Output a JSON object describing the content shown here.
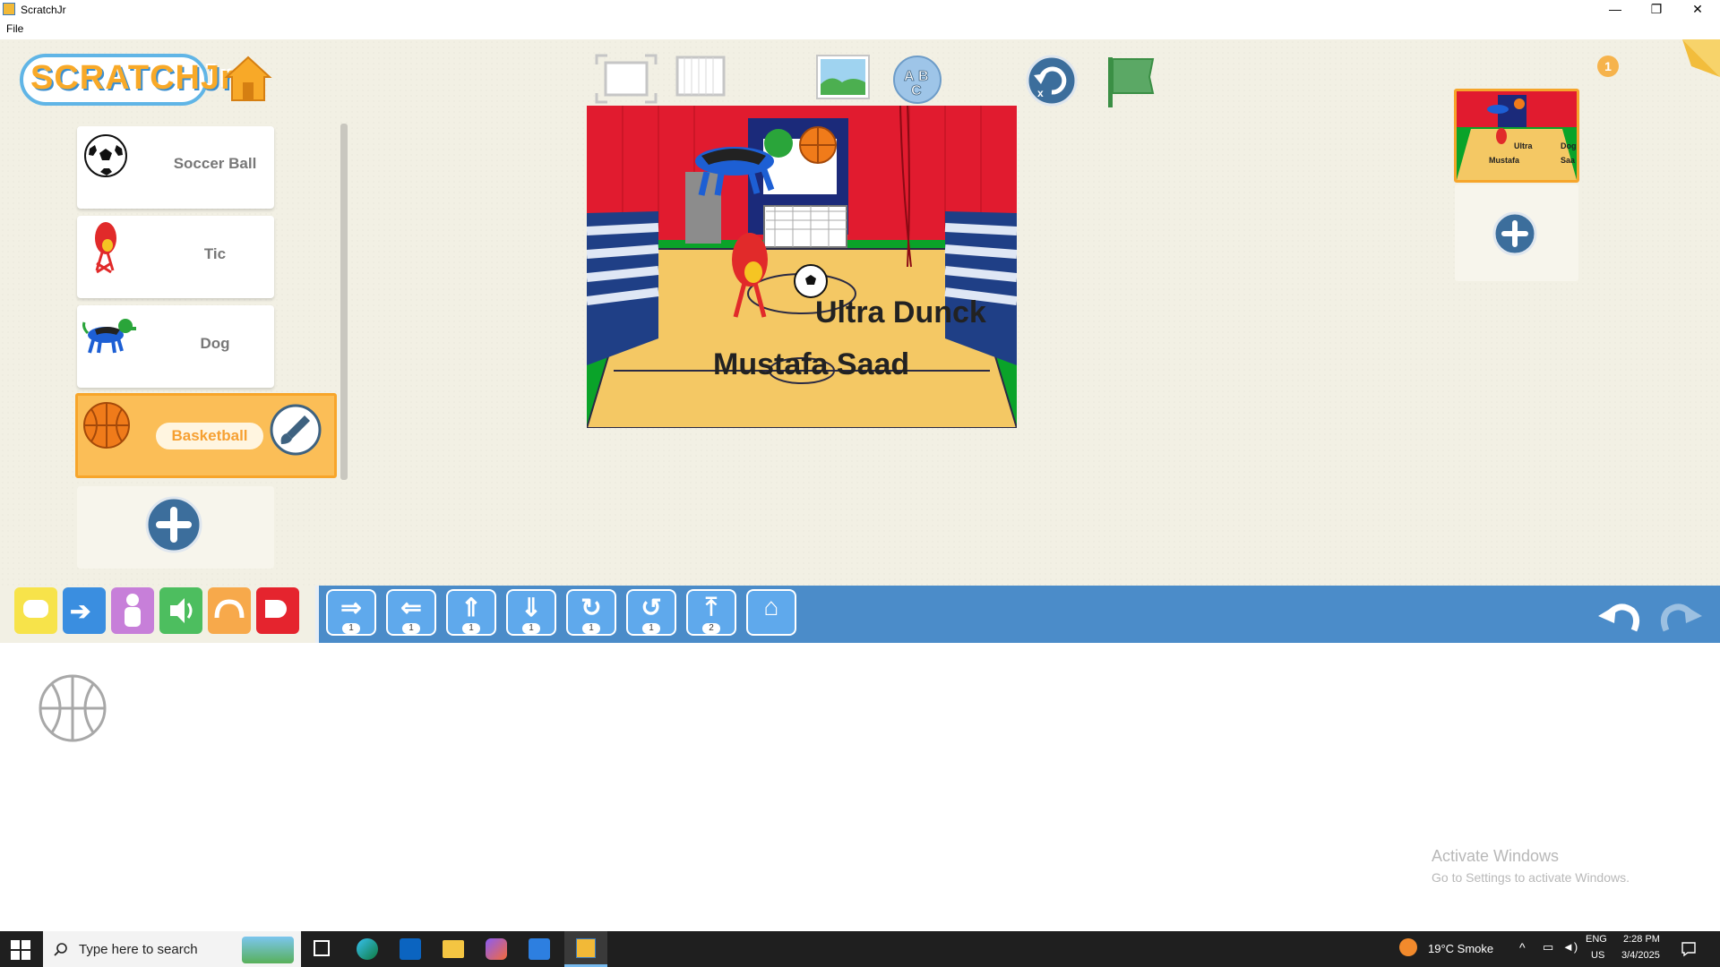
{
  "window": {
    "title": "ScratchJr",
    "minimize": "—",
    "restore": "❐",
    "close": "✕"
  },
  "menu": {
    "file": "File"
  },
  "logo": {
    "text": "SCRATCHJr"
  },
  "sprites": [
    {
      "name": "Soccer Ball",
      "icon": "soccer-ball-icon"
    },
    {
      "name": "Tic",
      "icon": "tic-character-icon"
    },
    {
      "name": "Dog",
      "icon": "dog-icon"
    },
    {
      "name": "Basketball",
      "icon": "basketball-icon",
      "selected": true
    }
  ],
  "stage": {
    "texts": [
      "Ultra Dunck",
      "Mustafa Saad"
    ]
  },
  "pages": {
    "count_badge": "1",
    "thumb_texts": [
      "Ultra",
      "Dog",
      "Mustafa",
      "Saa"
    ]
  },
  "palette": {
    "categories": [
      {
        "name": "triggering",
        "color": "#f7e34a"
      },
      {
        "name": "motion",
        "color": "#3a8ee0"
      },
      {
        "name": "looks",
        "color": "#c77fd9"
      },
      {
        "name": "sound",
        "color": "#4dbe5f"
      },
      {
        "name": "control",
        "color": "#f7a94b"
      },
      {
        "name": "end",
        "color": "#e5242e"
      }
    ],
    "blocks": [
      {
        "name": "move-right",
        "count": "1"
      },
      {
        "name": "move-left",
        "count": "1"
      },
      {
        "name": "move-up",
        "count": "1"
      },
      {
        "name": "move-down",
        "count": "1"
      },
      {
        "name": "turn-right",
        "count": "1"
      },
      {
        "name": "turn-left",
        "count": "1"
      },
      {
        "name": "hop",
        "count": "2"
      },
      {
        "name": "go-home",
        "count": ""
      }
    ]
  },
  "watermark": {
    "line1": "Activate Windows",
    "line2": "Go to Settings to activate Windows."
  },
  "taskbar": {
    "search_placeholder": "Type here to search",
    "weather": "19°C  Smoke",
    "lang1": "ENG",
    "lang2": "US",
    "time": "2:28 PM",
    "date": "3/4/2025"
  }
}
